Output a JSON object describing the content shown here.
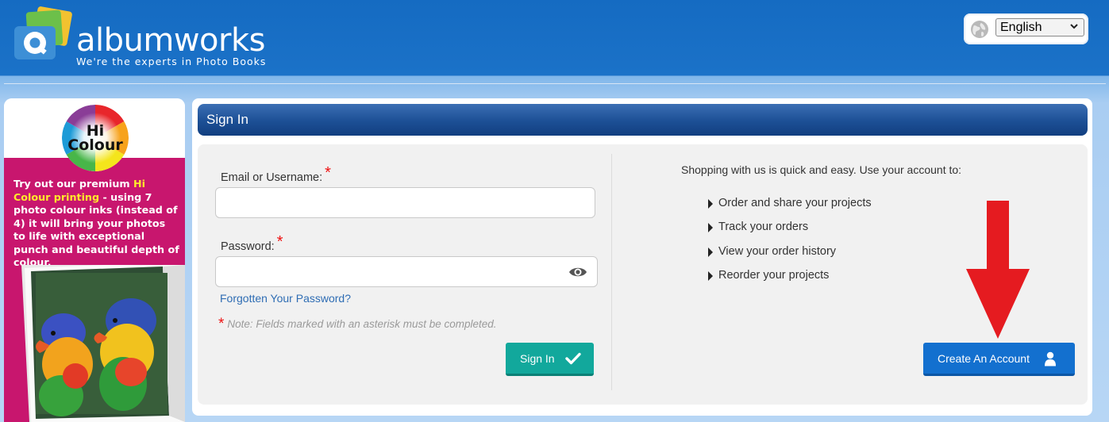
{
  "header": {
    "logo_text": "albumworks",
    "tagline": "We're the experts in Photo Books",
    "language": {
      "selected": "English"
    }
  },
  "promo": {
    "badge_line1": "Hi",
    "badge_line2": "Colour",
    "text_part1": "Try out our premium ",
    "text_highlight": "Hi Colour printing",
    "text_part2": " - using 7 photo colour inks (instead of 4) it will bring your photos to life with exceptional punch and beautiful depth of colour."
  },
  "signin": {
    "title": "Sign In",
    "email_label": "Email or Username:",
    "email_value": "",
    "password_label": "Password:",
    "password_value": "",
    "required_mark": "*",
    "forgot_link": "Forgotten Your Password?",
    "note": "Note: Fields marked with an asterisk must be completed.",
    "signin_button": "Sign In"
  },
  "account": {
    "intro": "Shopping with us is quick and easy. Use your account to:",
    "benefits": [
      "Order and share your projects",
      "Track your orders",
      "View your order history",
      "Reorder your projects"
    ],
    "create_button": "Create An Account"
  },
  "colors": {
    "header_blue": "#1b6bbf",
    "title_bar": "#1c4f95",
    "signin_teal": "#12a89c",
    "create_blue": "#1370cf",
    "promo_pink": "#c8166e",
    "arrow_red": "#e51b20"
  }
}
